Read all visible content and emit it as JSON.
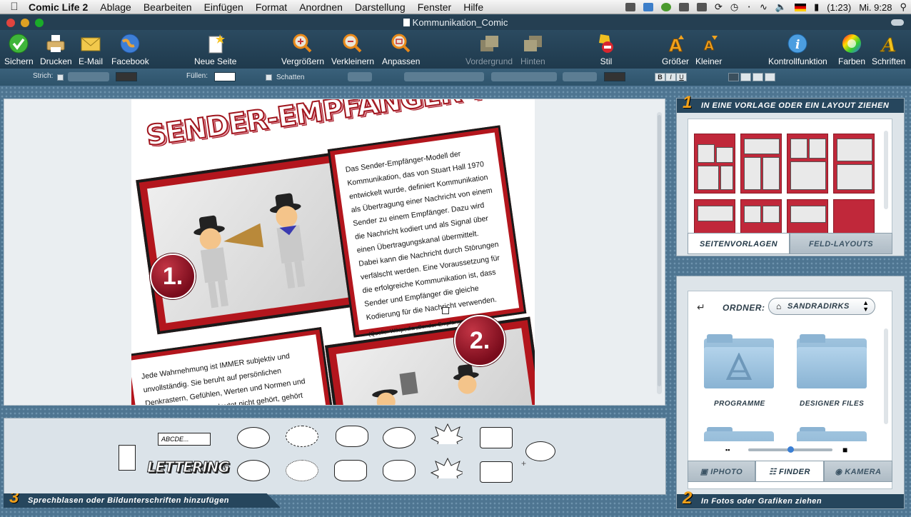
{
  "menubar": {
    "app_name": "Comic Life 2",
    "items": [
      "Ablage",
      "Bearbeiten",
      "Einfügen",
      "Format",
      "Anordnen",
      "Darstellung",
      "Fenster",
      "Hilfe"
    ],
    "battery": "(1:23)",
    "clock": "Mi. 9:28"
  },
  "window": {
    "title": "Kommunikation_Comic"
  },
  "toolbar": {
    "sichern": "Sichern",
    "drucken": "Drucken",
    "email": "E-Mail",
    "facebook": "Facebook",
    "neue_seite": "Neue Seite",
    "vergroessern": "Vergrößern",
    "verkleinern": "Verkleinern",
    "anpassen": "Anpassen",
    "vordergrund": "Vordergrund",
    "hinten": "Hinten",
    "stil": "Stil",
    "groesser": "Größer",
    "kleiner": "Kleiner",
    "kontrollfunktion": "Kontrollfunktion",
    "farben": "Farben",
    "schriften": "Schriften"
  },
  "formatbar": {
    "strich": "Strich:",
    "fuellen": "Füllen:",
    "schatten": "Schatten",
    "bold": "B",
    "italic": "I",
    "underline": "U"
  },
  "comic": {
    "title": "SENDER-EMPFÄNGER-MODELL",
    "badge1": "1.",
    "badge2": "2.",
    "text1": "Das Sender-Empfänger-Modell der Kommunikation, das von Stuart Hall 1970 entwickelt wurde, definiert Kommunikation als Übertragung einer Nachricht von einem Sender zu einem Empfänger. Dazu wird die Nachricht kodiert und als Signal über einen Übertragungskanal übermittelt. Dabei kann die Nachricht durch Störungen verfälscht werden. Eine Voraussetzung für die erfolgreiche Kommunikation ist, dass Sender und Empfänger die gleiche Kodierung für die Nachricht verwenden.",
    "source": "(Quelle: Wikipedia „Sender-Empfänger-Modell“)",
    "text2": "Jede Wahrnehmung ist IMMER subjektiv und unvollständig. Sie beruht auf persönlichen Denkrastern, Gefühlen, Werten und Normen und Vorurteilen. 100% bedeutet nicht gehört, gehört heißt nicht verstanden, verstanden heißt nicht einverstanden"
  },
  "templates_panel": {
    "number": "1",
    "header": "In eine Vorlage oder ein Layout ziehen",
    "tab_seitenvorlagen": "Seitenvorlagen",
    "tab_feldlayouts": "Feld-Layouts"
  },
  "media_panel": {
    "number": "2",
    "footer": "In Fotos oder Grafiken ziehen",
    "ordner_label": "Ordner:",
    "ordner_value": "sandradirks",
    "folders": [
      "Programme",
      "Designer Files"
    ],
    "tab_iphoto": "iPhoto",
    "tab_finder": "Finder",
    "tab_kamera": "Kamera"
  },
  "bubbles_panel": {
    "number": "3",
    "footer": "Sprechblasen oder Bildunterschriften hinzufügen",
    "caption_sample": "ABCDE...",
    "lettering": "LETTERING"
  },
  "colors": {
    "toolbar": "#253f52",
    "comic_red": "#b3161d",
    "badge_red": "#7a0c1c",
    "accent_orange": "#f0a01a"
  }
}
